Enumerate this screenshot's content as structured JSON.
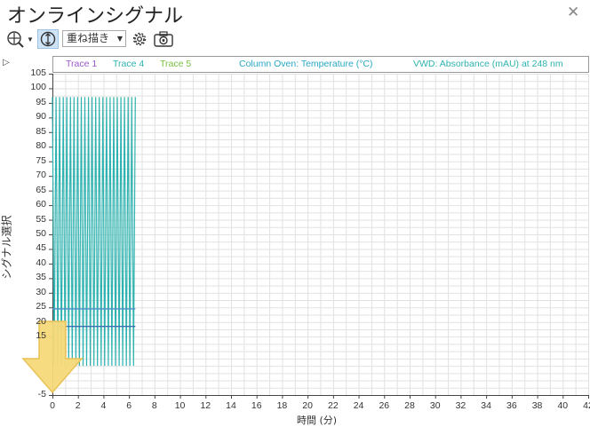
{
  "window": {
    "title": "オンラインシグナル",
    "close_icon": "close-icon"
  },
  "toolbar": {
    "zoom_icon": "zoom-crosshair-icon",
    "zoom_dropdown_icon": "chevron-down-icon",
    "vertical_zoom_icon": "vertical-zoom-icon",
    "overlay_select": "重ね描き",
    "settings_icon": "gear-icon",
    "snapshot_icon": "camera-icon"
  },
  "legend": {
    "trace1": "Trace 1",
    "trace4": "Trace 4",
    "trace5": "Trace 5",
    "oven": "Column Oven: Temperature (°C)",
    "vwd": "VWD: Absorbance (mAU) at 248 nm"
  },
  "chart_data": {
    "type": "line",
    "xlabel": "時間 (分)",
    "ylabel": "シグナル選択",
    "xlim": [
      0,
      42
    ],
    "ylim": [
      -5,
      105
    ],
    "x_ticks": [
      0,
      2,
      4,
      6,
      8,
      10,
      12,
      14,
      16,
      18,
      20,
      22,
      24,
      26,
      28,
      30,
      32,
      34,
      36,
      38,
      40,
      42
    ],
    "y_ticks": [
      105,
      100,
      95,
      90,
      85,
      80,
      75,
      70,
      65,
      60,
      55,
      50,
      45,
      40,
      35,
      30,
      25,
      20,
      15,
      -5
    ],
    "grid": true,
    "series": [
      {
        "name": "Trace 4",
        "color": "#2fb3b0",
        "pattern": "oscillating",
        "x_range": [
          0,
          6.5
        ],
        "y_range": [
          5,
          97
        ]
      }
    ],
    "hlines": [
      {
        "y": 24.5,
        "color": "#4a8fc8"
      },
      {
        "y": 18.5,
        "color": "#3a6fb0"
      }
    ]
  },
  "colors": {
    "trace1": "#9b59c8",
    "trace4": "#2fb3b0",
    "trace5": "#79c043",
    "oven": "#2aa8c6",
    "vwd": "#2fb3b0",
    "arrow_fill": "#f7d97a",
    "arrow_stroke": "#e8c257"
  }
}
